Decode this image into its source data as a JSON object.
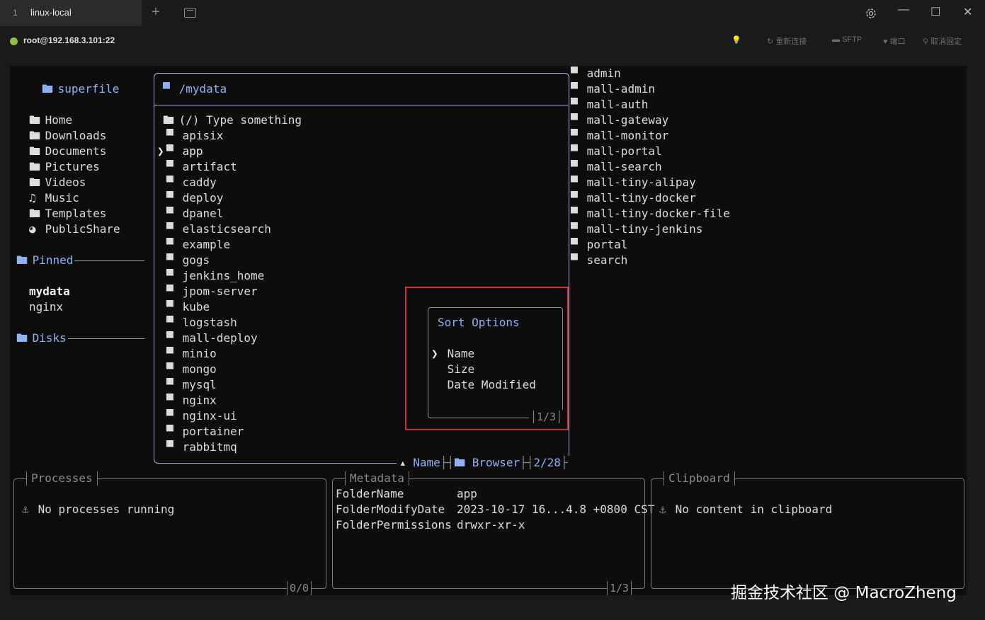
{
  "window": {
    "tab_index": "1",
    "tab_title": "linux-local",
    "new_tab_glyph": "+",
    "minimize_glyph": "—",
    "maximize_glyph": "☐",
    "close_glyph": "✕"
  },
  "toolbar": {
    "connection": "root@192.168.3.101:22",
    "status_color": "#8bc34a",
    "tip_glyph": "💡",
    "reconnect": "重新连接",
    "sftp": "SFTP",
    "ports": "端口",
    "unpin": "取消固定"
  },
  "sidebar": {
    "app_icon": "🖿",
    "app_name": "superfile",
    "places": [
      {
        "icon": "🖿",
        "label": "Home"
      },
      {
        "icon": "🖿",
        "label": "Downloads"
      },
      {
        "icon": "🖿",
        "label": "Documents"
      },
      {
        "icon": "🖿",
        "label": "Pictures"
      },
      {
        "icon": "🖿",
        "label": "Videos"
      },
      {
        "icon": "♫",
        "label": "Music"
      },
      {
        "icon": "🖿",
        "label": "Templates"
      },
      {
        "icon": "◕",
        "label": "PublicShare"
      }
    ],
    "pinned_heading": "Pinned",
    "pinned": [
      "mydata",
      "nginx"
    ],
    "disks_heading": "Disks"
  },
  "file_panel": {
    "path": "/mydata",
    "search_placeholder": "(/) Type something",
    "cursor": "❯",
    "folder_icon": "▀",
    "items": [
      "apisix",
      "app",
      "artifact",
      "caddy",
      "deploy",
      "dpanel",
      "elasticsearch",
      "example",
      "gogs",
      "jenkins_home",
      "jpom-server",
      "kube",
      "logstash",
      "mall-deploy",
      "minio",
      "mongo",
      "mysql",
      "nginx",
      "nginx-ui",
      "portainer",
      "rabbitmq"
    ],
    "selected_index": 1,
    "footer_sort": "Name",
    "footer_mode": "Browser",
    "footer_count": "2/28"
  },
  "preview": {
    "items": [
      "admin",
      "mall-admin",
      "mall-auth",
      "mall-gateway",
      "mall-monitor",
      "mall-portal",
      "mall-search",
      "mall-tiny-alipay",
      "mall-tiny-docker",
      "mall-tiny-docker-file",
      "mall-tiny-jenkins",
      "portal",
      "search"
    ]
  },
  "sort_menu": {
    "title": "Sort Options",
    "options": [
      "Name",
      "Size",
      "Date Modified"
    ],
    "selected_index": 0,
    "counter": "1/3"
  },
  "processes": {
    "title": "Processes",
    "message": "No processes running",
    "counter": "0/0"
  },
  "metadata": {
    "title": "Metadata",
    "rows": [
      {
        "key": "FolderName",
        "value": "app"
      },
      {
        "key": "FolderModifyDate",
        "value": "2023-10-17 16...4.8 +0800 CST"
      },
      {
        "key": "FolderPermissions",
        "value": "drwxr-xr-x"
      }
    ],
    "counter": "1/3"
  },
  "clipboard": {
    "title": "Clipboard",
    "message": "No content in clipboard"
  },
  "watermark": "掘金技术社区 @ MacroZheng"
}
